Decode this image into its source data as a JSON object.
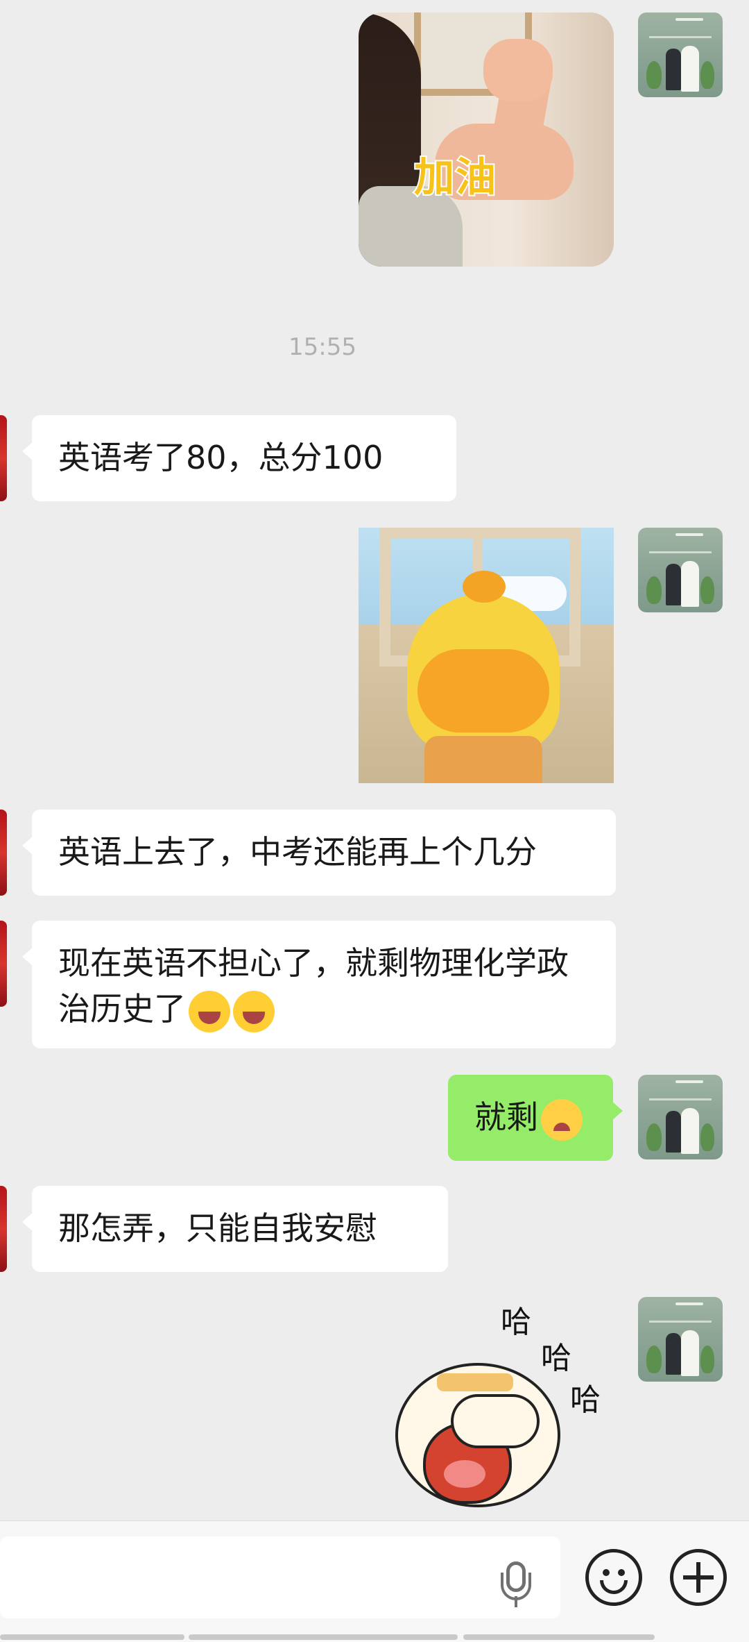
{
  "time_divider": "15:55",
  "messages": [
    {
      "side": "left",
      "text": "英语考了80，总分100"
    },
    {
      "side": "left",
      "text": "英语上去了，中考还能再上个几分"
    },
    {
      "side": "left",
      "text": "现在英语不担心了，就剩物理化学政治历史了",
      "emoji": [
        "grinning-squint-icon",
        "grinning-squint-icon"
      ]
    },
    {
      "side": "right",
      "text": "就剩",
      "emoji": [
        "crying-face-icon"
      ]
    },
    {
      "side": "left",
      "text": "那怎弄，只能自我安慰"
    }
  ],
  "stickers": {
    "jiayou_text": "加油",
    "laugh_1": "哈",
    "laugh_2": "哈",
    "laugh_3": "哈"
  },
  "input": {
    "placeholder": ""
  },
  "colors": {
    "background": "#ededed",
    "my_bubble": "#95ec69",
    "other_bubble": "#ffffff"
  }
}
